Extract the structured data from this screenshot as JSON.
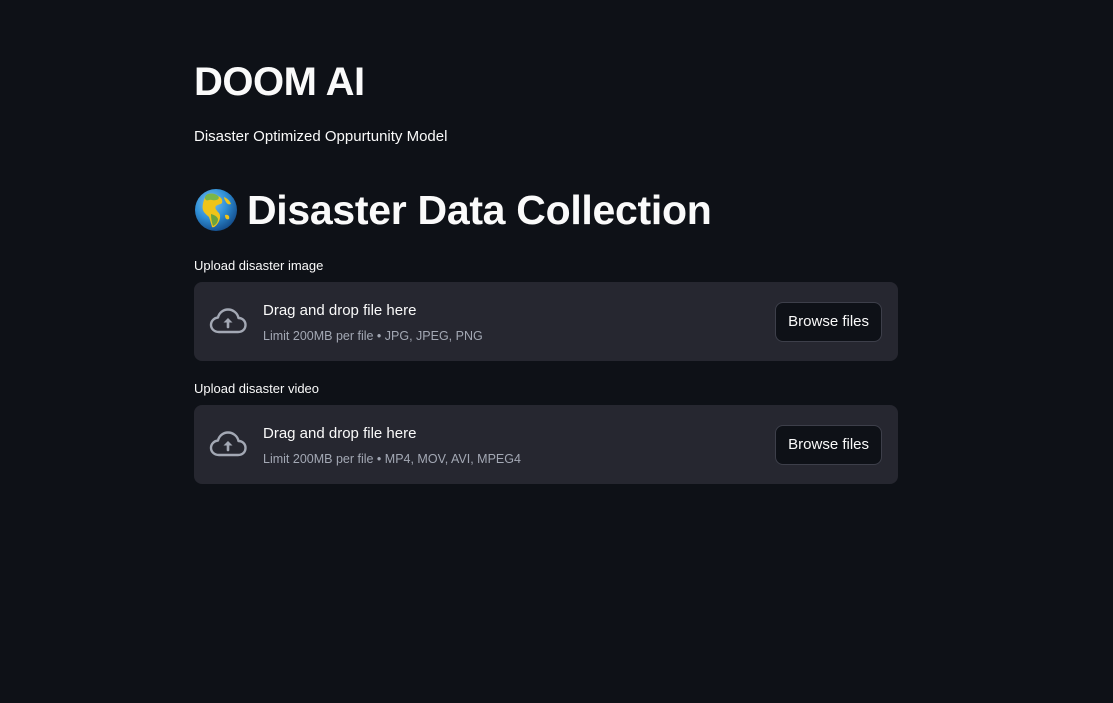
{
  "app": {
    "title": "DOOM AI",
    "subtitle": "Disaster Optimized Oppurtunity Model"
  },
  "section": {
    "icon": "globe-europe-africa-icon",
    "heading": "Disaster Data Collection"
  },
  "uploaders": [
    {
      "label": "Upload disaster image",
      "drop_text": "Drag and drop file here",
      "limit_text": "Limit 200MB per file • JPG, JPEG, PNG",
      "button_label": "Browse files",
      "icon": "cloud-upload-icon"
    },
    {
      "label": "Upload disaster video",
      "drop_text": "Drag and drop file here",
      "limit_text": "Limit 200MB per file • MP4, MOV, AVI, MPEG4",
      "button_label": "Browse files",
      "icon": "cloud-upload-icon"
    }
  ],
  "colors": {
    "background": "#0e1117",
    "dropzone": "#262730",
    "text": "#fafafa",
    "muted_text": "#a3a8b4"
  }
}
